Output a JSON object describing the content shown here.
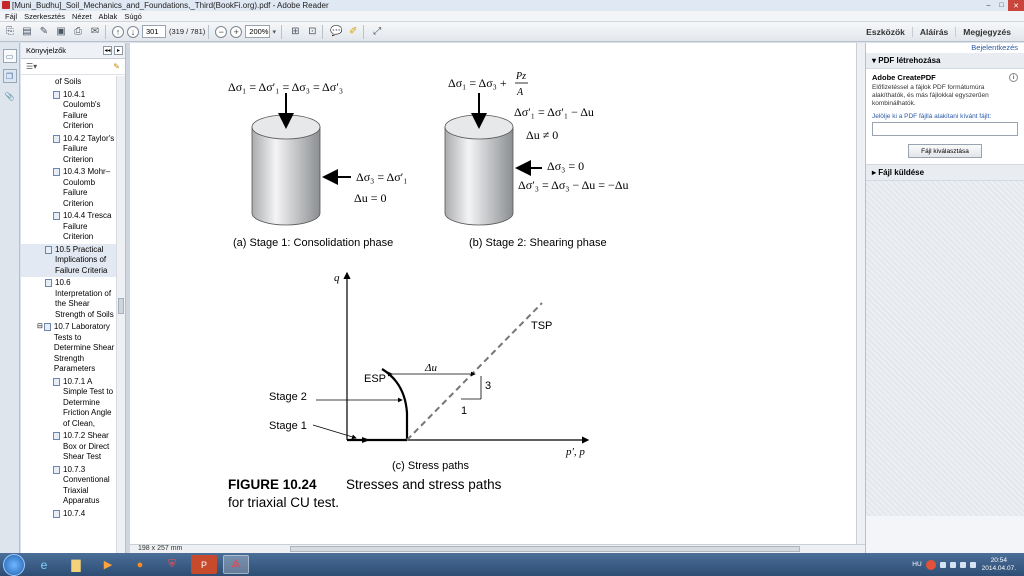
{
  "window": {
    "title": "[Muni_Budhu]_Soil_Mechanics_and_Foundations,_Third(BookFi.org).pdf - Adobe Reader",
    "controls": [
      "–",
      "□",
      "✕"
    ]
  },
  "menu": [
    "Fájl",
    "Szerkesztés",
    "Nézet",
    "Ablak",
    "Súgó"
  ],
  "toolbar": {
    "page_number": "301",
    "page_count": "(319 / 781)",
    "zoom": "200%",
    "right_tabs": [
      "Eszközök",
      "Aláírás",
      "Megjegyzés"
    ]
  },
  "bookmarks": {
    "title": "Könyvjelzők",
    "items": [
      {
        "label": "of Soils"
      },
      {
        "label": "10.4.1 Coulomb's Failure Criterion"
      },
      {
        "label": "10.4.2 Taylor's Failure Criterion"
      },
      {
        "label": "10.4.3 Mohr–Coulomb Failure Criterion"
      },
      {
        "label": "10.4.4 Tresca Failure Criterion"
      },
      {
        "label": "10.5 Practical Implications of Failure Criteria"
      },
      {
        "label": "10.6 Interpretation of the Shear Strength of Soils"
      },
      {
        "label": "10.7 Laboratory Tests to Determine Shear Strength Parameters"
      },
      {
        "label": "10.7.1 A Simple Test to Determine Friction Angle of Clean,"
      },
      {
        "label": "10.7.2 Shear Box or Direct Shear Test"
      },
      {
        "label": "10.7.3 Conventional Triaxial Apparatus"
      },
      {
        "label": "10.7.4"
      }
    ]
  },
  "document": {
    "stage1": {
      "eq_top": "Δσ₁ = Δσ′₁ = Δσ₃ = Δσ′₃",
      "eq_side1": "Δσ₃ = Δσ′₁",
      "eq_side2": "Δu = 0",
      "caption": "(a) Stage 1: Consolidation phase"
    },
    "stage2": {
      "eq_top_left": "Δσ₁ = Δσ₃ +",
      "eq_top_num": "Pz",
      "eq_top_den": "A",
      "eq1": "Δσ′₁ = Δσ′₁ − Δu",
      "eq2": "Δu ≠ 0",
      "eq3": "Δσ₃ = 0",
      "eq4": "Δσ′₃ = Δσ₃ − Δu = −Δu",
      "caption": "(b) Stage 2: Shearing phase"
    },
    "stress_path": {
      "y_axis": "q",
      "x_axis": "p′, p",
      "tsp": "TSP",
      "esp": "ESP",
      "du": "Δu",
      "slope_rise": "3",
      "slope_run": "1",
      "stage2": "Stage 2",
      "stage1": "Stage 1",
      "caption": "(c) Stress paths"
    },
    "figure": {
      "number": "FIGURE 10.24",
      "text_line1": "Stresses and stress paths",
      "text_line2": "for triaxial CU test."
    },
    "page_size": "198 x 257 mm"
  },
  "right_panel": {
    "login": "Bejelentkezés",
    "section1": "PDF létrehozása",
    "adobe_title": "Adobe CreatePDF",
    "description": "Előfizetéssel a fájlok PDF formátumúra alakíthatók, és más fájlokkal egyszerűen kombinálhatók.",
    "select_label": "Jelölje ki a PDF fájllá alakítani kívánt fájlt:",
    "button": "Fájl kiválasztása",
    "section2": "Fájl küldése"
  },
  "taskbar": {
    "lang": "HU",
    "time": "20:54",
    "date": "2014.04.07."
  }
}
